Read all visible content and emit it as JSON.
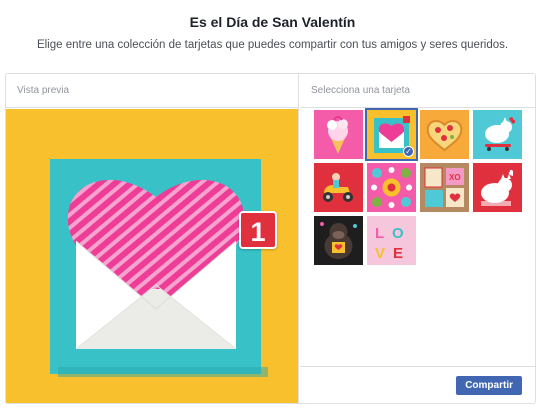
{
  "header": {
    "title": "Es el Día de San Valentín",
    "subtitle": "Elige entre una colección de tarjetas que puedes compartir con tus amigos y seres queridos."
  },
  "preview": {
    "label": "Vista previa",
    "badge_count": "1",
    "logo_icon": "facebook-logo-icon"
  },
  "picker": {
    "label": "Selecciona una tarjeta",
    "selected_index": 1,
    "cards": [
      {
        "name": "ice-cream-card"
      },
      {
        "name": "heart-envelope-card"
      },
      {
        "name": "heart-pizza-card"
      },
      {
        "name": "skateboard-cat-card"
      },
      {
        "name": "scooter-card"
      },
      {
        "name": "flower-pattern-card"
      },
      {
        "name": "xo-stamps-card"
      },
      {
        "name": "cat-love-card"
      },
      {
        "name": "gorilla-card"
      },
      {
        "name": "love-letters-card"
      }
    ],
    "share_label": "Compartir"
  },
  "colors": {
    "brand_blue": "#4267b2",
    "preview_background": "#f8c02c",
    "envelope_teal": "#38c2c7",
    "heart_pink": "#ee3d96",
    "badge_red": "#e0303e"
  }
}
